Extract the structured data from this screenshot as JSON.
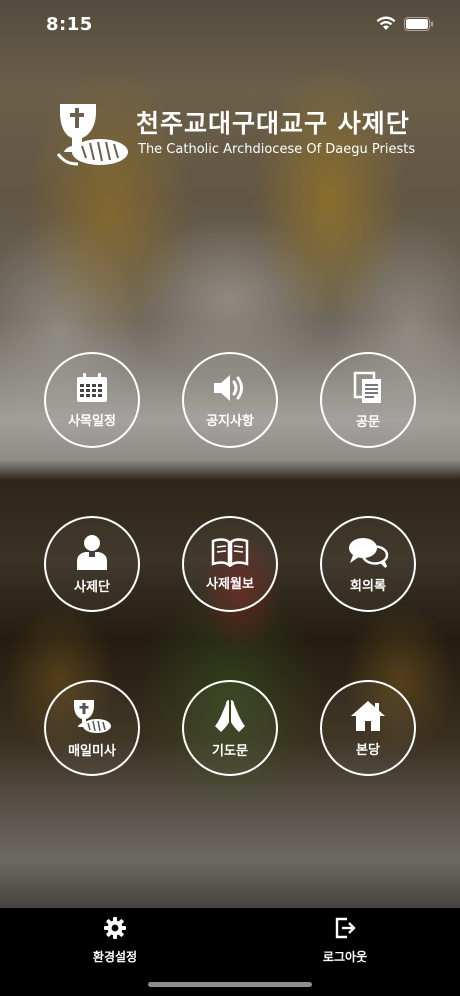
{
  "status_bar": {
    "time": "8:15",
    "icons": [
      "wifi-icon",
      "battery-icon"
    ]
  },
  "header": {
    "title": "천주교대구대교구 사제단",
    "subtitle": "The Catholic Archdiocese Of Daegu Priests",
    "logo_icon": "chalice-bread-icon"
  },
  "menu": {
    "items": [
      {
        "label": "사목일정",
        "icon": "calendar-icon"
      },
      {
        "label": "공지사항",
        "icon": "speaker-icon"
      },
      {
        "label": "공문",
        "icon": "documents-icon"
      },
      {
        "label": "사제단",
        "icon": "priest-icon"
      },
      {
        "label": "사제월보",
        "icon": "open-book-icon"
      },
      {
        "label": "회의록",
        "icon": "chat-bubbles-icon"
      },
      {
        "label": "매일미사",
        "icon": "chalice-icon"
      },
      {
        "label": "기도문",
        "icon": "praying-hands-icon"
      },
      {
        "label": "본당",
        "icon": "home-icon"
      }
    ]
  },
  "bottom_bar": {
    "settings_label": "환경설정",
    "settings_icon": "gear-icon",
    "logout_label": "로그아웃",
    "logout_icon": "logout-icon"
  },
  "colors": {
    "accent": "#ffffff",
    "bottom_bar": "#000000"
  }
}
